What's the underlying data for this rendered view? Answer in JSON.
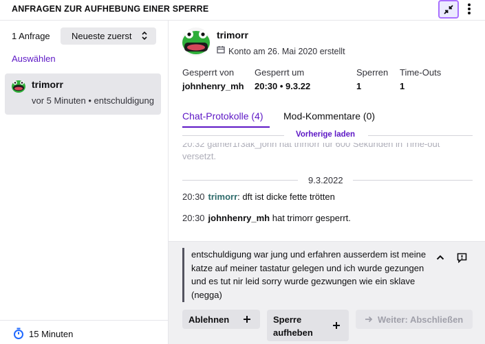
{
  "header": {
    "title": "ANFRAGEN ZUR AUFHEBUNG EINER SPERRE",
    "collapse_icon": "collapse-arrows-icon",
    "more_icon": "vertical-dots-icon",
    "accent": "#a970ff"
  },
  "sidebar": {
    "request_count": "1 Anfrage",
    "sort_label": "Neueste zuerst",
    "select_label": "Auswählen",
    "requests": [
      {
        "user": "trimorr",
        "meta": "vor 5 Minuten • entschuldigung"
      }
    ],
    "footer_label": "15 Minuten"
  },
  "detail": {
    "user": "trimorr",
    "created": "Konto am 26. Mai 2020 erstellt",
    "stats": {
      "banned_by_label": "Gesperrt von",
      "banned_by_value": "johnhenry_mh",
      "banned_at_label": "Gesperrt um",
      "banned_at_value": "20:30 • 9.3.22",
      "bans_label": "Sperren",
      "bans_value": "1",
      "timeouts_label": "Time-Outs",
      "timeouts_value": "1"
    },
    "tabs": [
      {
        "label": "Chat-Protokolle (4)"
      },
      {
        "label": "Mod-Kommentare (0)"
      }
    ],
    "load_previous": "Vorherige laden",
    "chat": {
      "faded_1": "20:32  gamer1r3ak_john hat trimorr für 600 Sekunden in Time-out",
      "faded_2": "versetzt.",
      "date": "9.3.2022",
      "lines": [
        {
          "time": "20:30",
          "nick": "trimorr",
          "text": ": dft ist dicke fette trötten"
        },
        {
          "time": "20:30",
          "nick": "johnhenry_mh",
          "text": " hat trimorr gesperrt."
        }
      ]
    },
    "appeal": {
      "text": "entschuldigung war jung und erfahren ausserdem ist meine katze auf meiner tastatur gelegen und ich wurde gezungen und es tut nir leid sorry wurde gezwungen wie ein sklave (negga)"
    },
    "buttons": {
      "deny": "Ablehnen",
      "lift": "Sperre aufheben",
      "next": "Weiter: Abschließen"
    },
    "link_color": "#5c16c5"
  }
}
